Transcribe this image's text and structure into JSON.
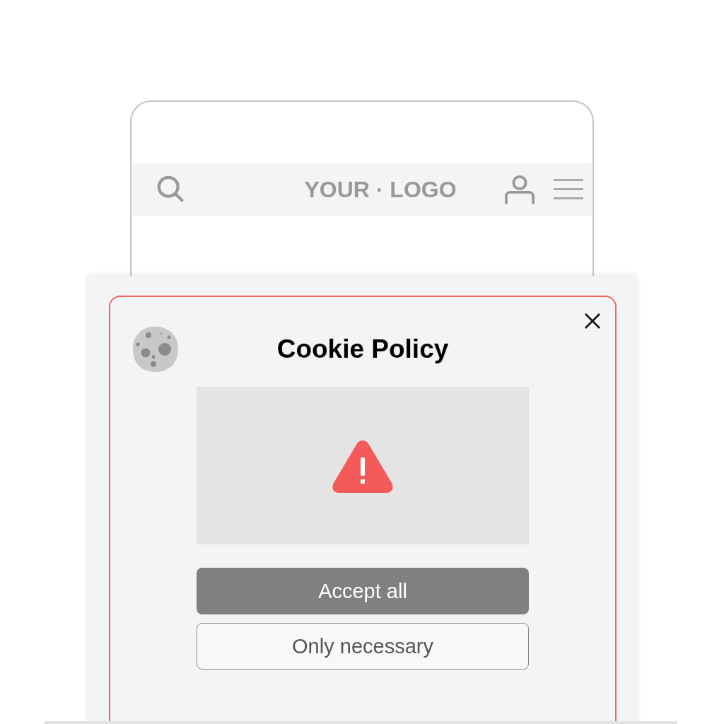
{
  "header": {
    "logo": "YOUR · LOGO"
  },
  "dialog": {
    "title": "Cookie Policy",
    "buttons": [
      {
        "label": "Accept all",
        "kind": "primary"
      },
      {
        "label": "Only necessary",
        "kind": "secondary"
      }
    ]
  }
}
